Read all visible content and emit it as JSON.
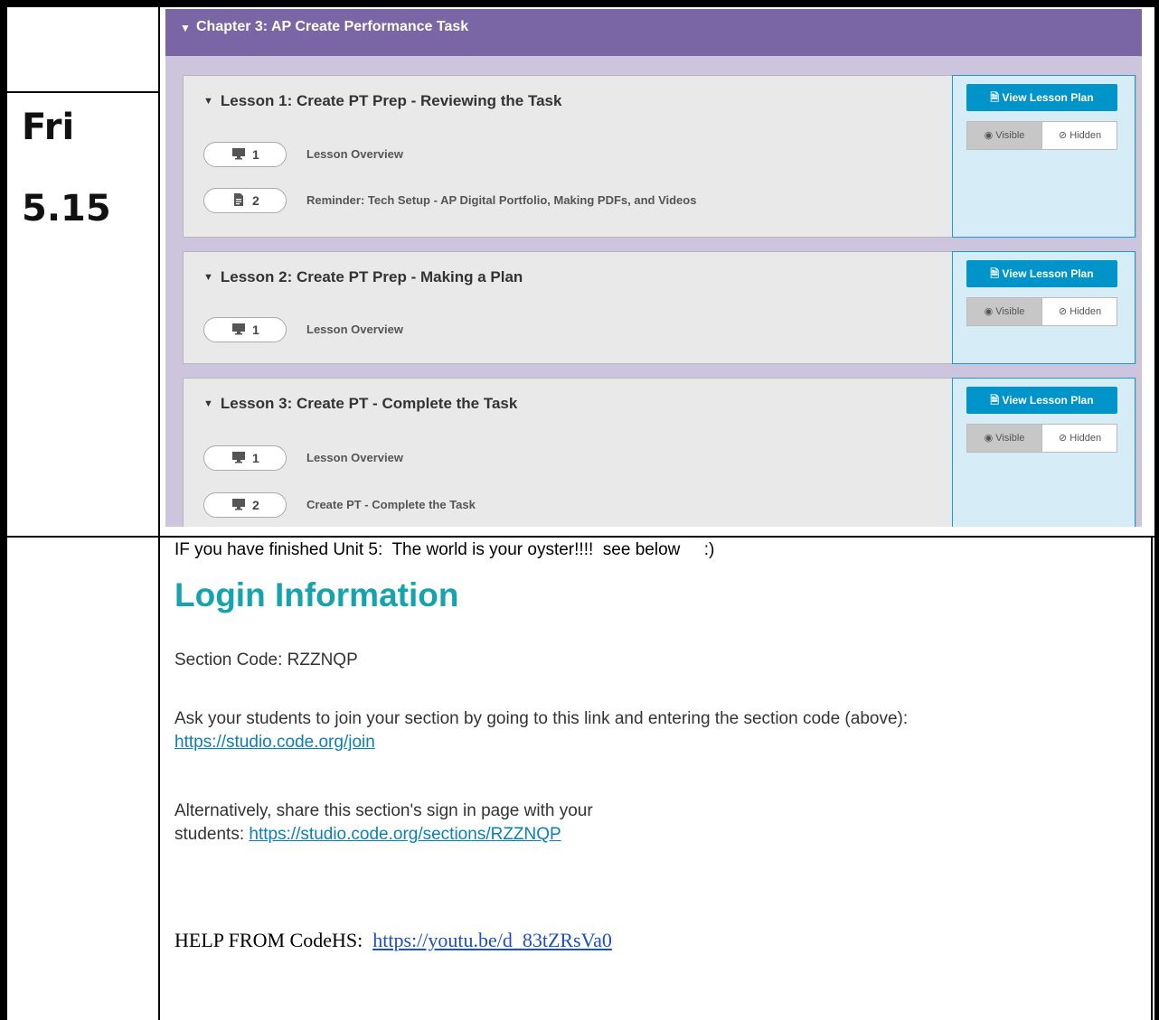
{
  "day": {
    "weekday": "Fri",
    "date": "5.15"
  },
  "chapter": {
    "title": "Chapter 3: AP Create Performance Task"
  },
  "lessons": [
    {
      "title": "Lesson 1: Create PT Prep - Reviewing the Task",
      "items": [
        {
          "num": "1",
          "icon": "monitor-icon",
          "text": "Lesson Overview"
        },
        {
          "num": "2",
          "icon": "document-icon",
          "text": "Reminder: Tech Setup - AP Digital Portfolio, Making PDFs, and Videos"
        }
      ]
    },
    {
      "title": "Lesson 2: Create PT Prep - Making a Plan",
      "items": [
        {
          "num": "1",
          "icon": "monitor-icon",
          "text": "Lesson Overview"
        }
      ]
    },
    {
      "title": "Lesson 3: Create PT - Complete the Task",
      "items": [
        {
          "num": "1",
          "icon": "monitor-icon",
          "text": "Lesson Overview"
        },
        {
          "num": "2",
          "icon": "monitor-icon",
          "text": "Create PT - Complete the Task"
        }
      ]
    }
  ],
  "side_panel": {
    "view_plan_label": "View Lesson Plan",
    "visible_label": "Visible",
    "hidden_label": "Hidden"
  },
  "notes": {
    "finished": "IF you have finished Unit 5:  The world is your oyster!!!!  see below     :)",
    "heading": "Login Information",
    "section_code": "Section Code: RZZNQP",
    "ask_text": "Ask your students to join your section by going to this link and entering the section code (above): ",
    "join_link": "https://studio.code.org/join",
    "alt_text_1": "Alternatively, share this section's sign in page with your",
    "alt_text_2": "students: ",
    "section_link": "https://studio.code.org/sections/RZZNQP",
    "help_label": "HELP FROM CodeHS:  ",
    "help_link": "https://youtu.be/d_83tZRsVa0"
  },
  "colors": {
    "chapter_bar": "#7a65a5",
    "accent_button": "#0094ca",
    "heading": "#16a3ad",
    "link": "#0b80b5"
  }
}
